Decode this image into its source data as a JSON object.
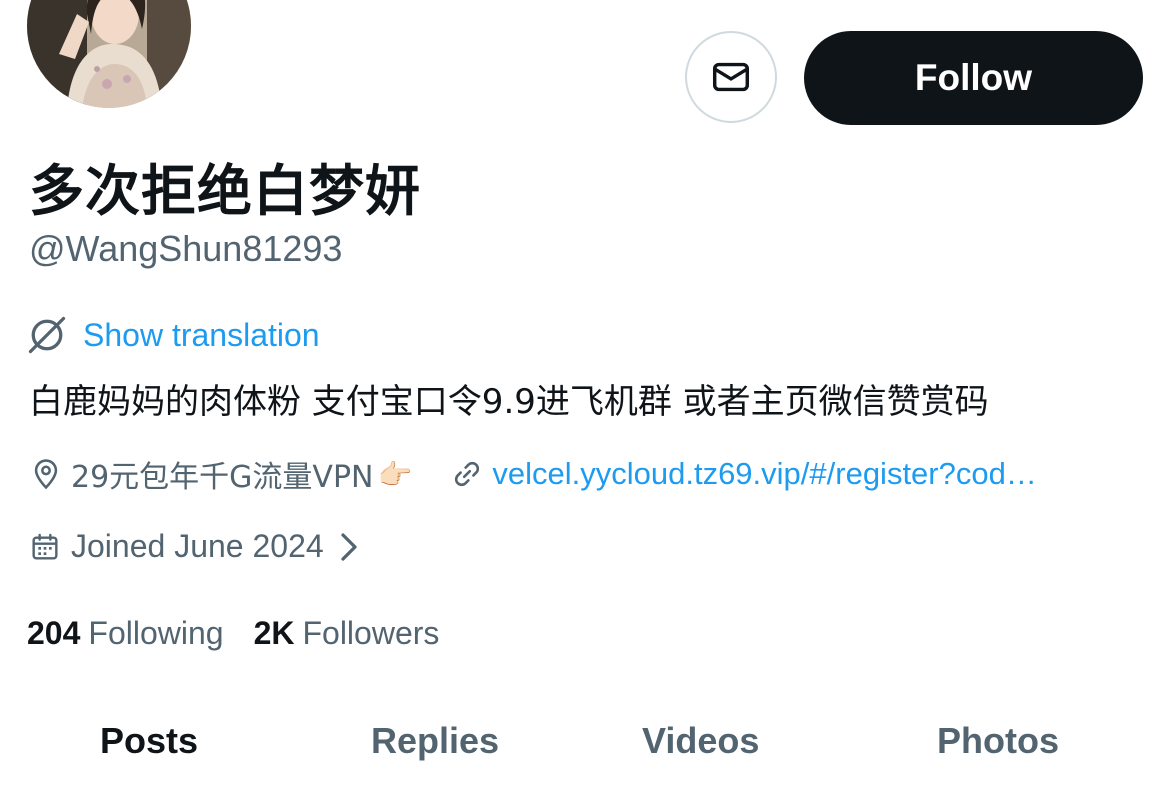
{
  "profile": {
    "display_name": "多次拒绝白梦妍",
    "handle": "@WangShun81293",
    "translate_label": "Show translation",
    "bio": "白鹿妈妈的肉体粉 支付宝口令9.9进飞机群 或者主页微信赞赏码",
    "location": "29元包年千G流量VPN",
    "location_emoji": "👉🏻",
    "website": "velcel.yycloud.tz69.vip/#/register?cod…",
    "joined": "Joined June 2024",
    "following_count": "204",
    "following_label": "Following",
    "followers_count": "2K",
    "followers_label": "Followers"
  },
  "actions": {
    "follow_label": "Follow",
    "message_icon": "envelope-icon"
  },
  "tabs": [
    {
      "label": "Posts",
      "active": true
    },
    {
      "label": "Replies",
      "active": false
    },
    {
      "label": "Videos",
      "active": false
    },
    {
      "label": "Photos",
      "active": false
    }
  ],
  "colors": {
    "text_primary": "#0f1419",
    "text_secondary": "#536471",
    "link": "#1d9bf0",
    "follow_button_bg": "#0f1419",
    "border": "#cfd9de"
  }
}
